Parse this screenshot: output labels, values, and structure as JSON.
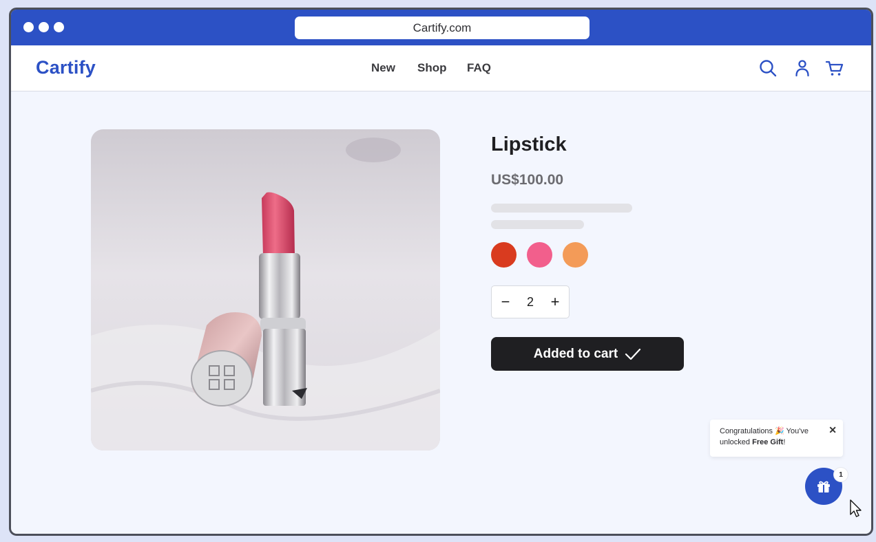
{
  "browser": {
    "url": "Cartify.com"
  },
  "header": {
    "logo": "Cartify",
    "nav": [
      "New",
      "Shop",
      "FAQ"
    ],
    "icons": [
      "search-icon",
      "user-icon",
      "cart-icon"
    ]
  },
  "product": {
    "title": "Lipstick",
    "price": "US$100.00",
    "swatches": [
      {
        "name": "red",
        "color": "#d93b1f"
      },
      {
        "name": "pink",
        "color": "#f25f8c"
      },
      {
        "name": "orange",
        "color": "#f39b58"
      }
    ],
    "quantity": "2",
    "decrement_label": "−",
    "increment_label": "+",
    "cart_button_label": "Added to cart"
  },
  "toast": {
    "text_before": "Congratulations",
    "text_middle": " You've unlocked ",
    "highlight": "Free Gift",
    "text_after": "!",
    "close_label": "✕"
  },
  "gift": {
    "badge_count": "1"
  },
  "colors": {
    "brand": "#2c51c5",
    "dark_button": "#1f1f22",
    "page_bg": "#f3f6fe"
  }
}
